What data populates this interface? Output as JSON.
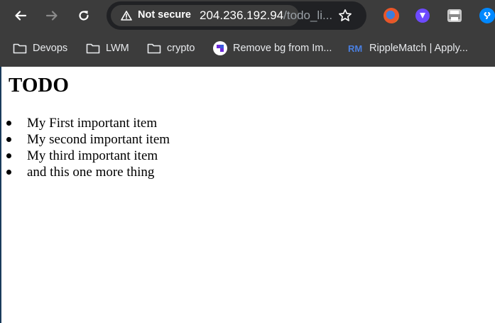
{
  "browser": {
    "security_label": "Not secure",
    "url_host": "204.236.192.94",
    "url_path": "/todo_li...",
    "bookmarks": [
      {
        "label": "Devops",
        "icon": "folder-icon"
      },
      {
        "label": "LWM",
        "icon": "folder-icon"
      },
      {
        "label": "crypto",
        "icon": "folder-icon"
      },
      {
        "label": "Remove bg from Im...",
        "icon": "removebg-icon"
      },
      {
        "label": "RippleMatch | Apply...",
        "icon": "ripplematch-icon"
      }
    ],
    "extensions": [
      "firefox-relay-icon",
      "proton-vpn-icon",
      "printer-icon",
      "shazam-icon"
    ]
  },
  "page": {
    "heading": "TODO",
    "items": [
      "My First important item",
      "My second important item",
      "My third important item",
      "and this one more thing"
    ]
  }
}
